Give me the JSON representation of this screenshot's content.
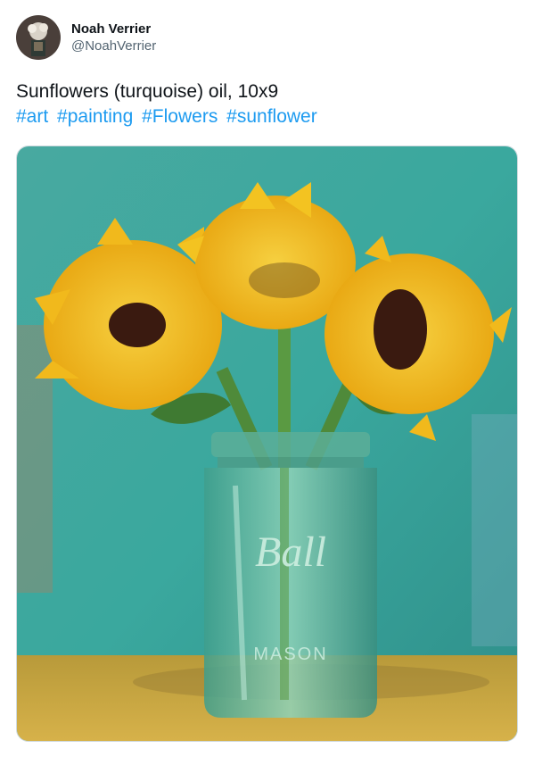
{
  "author": {
    "display_name": "Noah Verrier",
    "handle": "@NoahVerrier",
    "avatar_icon": "painting-avatar-icon"
  },
  "tweet": {
    "text": "Sunflowers (turquoise) oil, 10x9",
    "hashtags": [
      "#art",
      "#painting",
      "#Flowers",
      "#sunflower"
    ],
    "hashtag_color": "#1d9bf0"
  },
  "media": {
    "subject_icon": "sunflower-painting-icon",
    "jar_label": "Ball",
    "jar_sublabel": "MASON",
    "colors": {
      "background": "#3fa8a0",
      "petals": "#f4c21e",
      "centers": "#3a1a10",
      "table": "#c9a640",
      "glass": "#5fb8a0"
    }
  }
}
